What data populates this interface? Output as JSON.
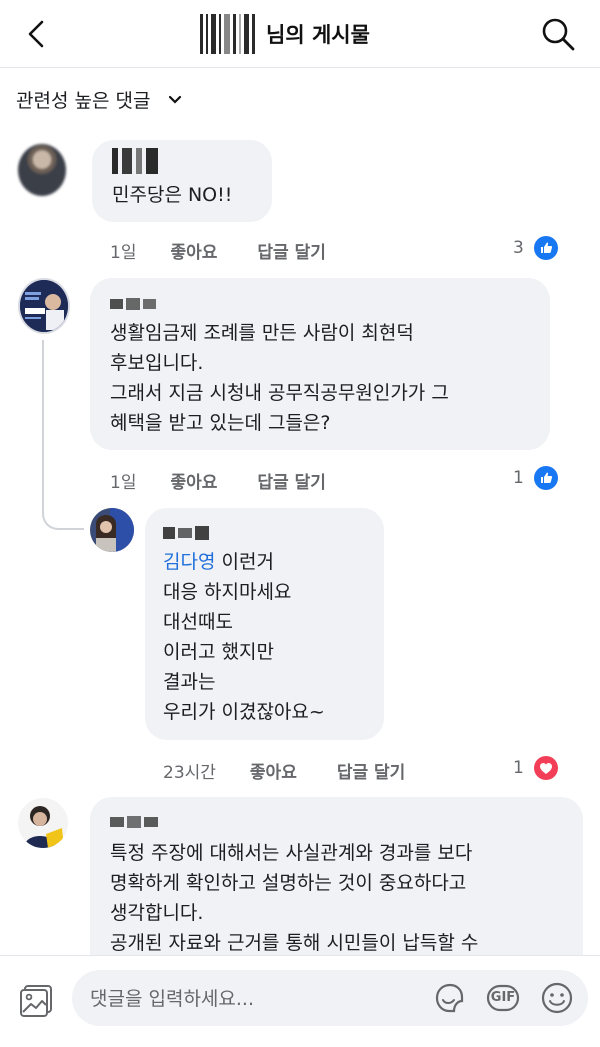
{
  "header": {
    "title": "님의 게시물",
    "back_icon": "chevron-left-icon",
    "search_icon": "search-icon"
  },
  "sort": {
    "label": "관련성 높은 댓글",
    "icon": "chevron-down-icon"
  },
  "comments": [
    {
      "text": "민주당은 NO!!",
      "time": "1일",
      "like_label": "좋아요",
      "reply_label": "답글 달기",
      "reaction_count": "3",
      "reaction": "like"
    },
    {
      "text_lines": [
        "생활임금제 조례를 만든 사람이 최현덕",
        "후보입니다.",
        "그래서 지금 시청내 공무직공무원인가가 그",
        "혜택을 받고 있는데 그들은?"
      ],
      "time": "1일",
      "like_label": "좋아요",
      "reply_label": "답글 달기",
      "reaction_count": "1",
      "reaction": "like"
    },
    {
      "mention": "김다영",
      "text_lines": [
        " 이런거",
        "대응 하지마세요",
        "대선때도",
        "이러고 했지만",
        "결과는",
        "우리가 이겼잖아요~"
      ],
      "time": "23시간",
      "like_label": "좋아요",
      "reply_label": "답글 달기",
      "reaction_count": "1",
      "reaction": "love"
    },
    {
      "text_lines": [
        "특정 주장에 대해서는 사실관계와 경과를 보다",
        "명확하게 확인하고 설명하는 것이 중요하다고",
        "생각합니다.",
        "공개된 자료와 근거를 통해 시민들이 납득할 수"
      ]
    }
  ],
  "composer": {
    "placeholder": "댓글을 입력하세요...",
    "gif_label": "GIF"
  },
  "colors": {
    "accent": "#1877f2",
    "love": "#f33e58",
    "bubble": "#f0f2f5"
  }
}
